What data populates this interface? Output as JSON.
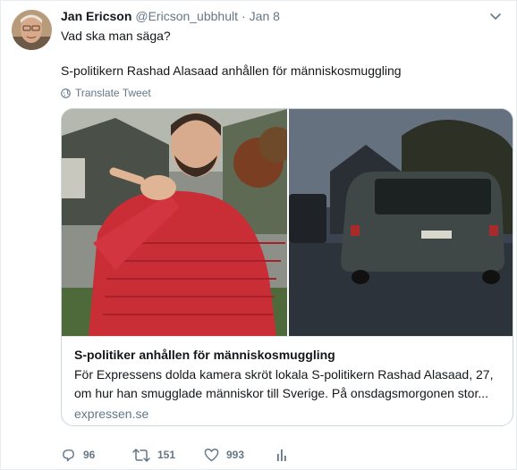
{
  "author": {
    "name": "Jan Ericson",
    "handle": "@Ericson_ubbhult",
    "separator": "·",
    "time": "Jan 8"
  },
  "tweet": {
    "line1": "Vad ska man säga?",
    "line2": "S-politikern Rashad Alasaad anhållen för människosmuggling"
  },
  "translate_label": "Translate Tweet",
  "card": {
    "title": "S-politiker anhållen för människosmuggling",
    "description": "För Expressens dolda kamera skröt lokala S-politikern Rashad Alasaad, 27, om hur han smugglade människor till Sverige. På onsdagsmorgonen stor...",
    "domain": "expressen.se"
  },
  "actions": {
    "replies": "96",
    "retweets": "151",
    "likes": "993"
  },
  "icons": {
    "reply": "reply-icon",
    "retweet": "retweet-icon",
    "like": "heart-icon",
    "analytics": "analytics-icon",
    "caret": "chevron-down-icon",
    "globe": "globe-icon"
  },
  "colors": {
    "text": "#14171a",
    "secondary": "#657786",
    "border": "#ccd6dd"
  }
}
